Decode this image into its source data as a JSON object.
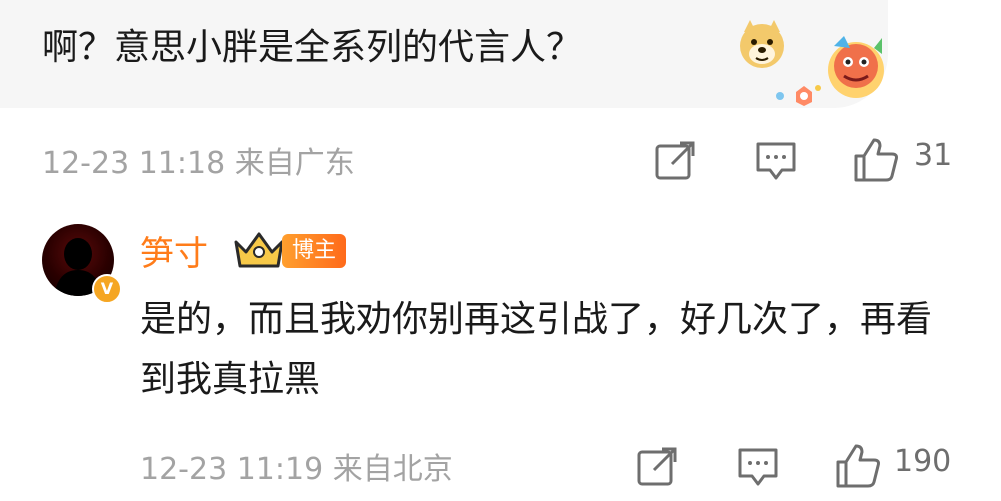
{
  "top_comment": {
    "text": "啊？意思小胖是全系列的代言人？",
    "emoji_name": "doge-emoji",
    "decoration": "lion-dance-badge",
    "date_time": "12-23 11:18",
    "location": "来自广东",
    "like_count": "31"
  },
  "reply": {
    "username": "笋寸",
    "crown_badge": "crown-icon",
    "role_tag": "博主",
    "text": "是的，而且我劝你别再这引战了，好几次了，再看到我真拉黑",
    "date_time": "12-23 11:19",
    "location": "来自北京",
    "like_count": "190"
  },
  "colors": {
    "username": "#ff7c1a",
    "meta_gray": "#a3a3a3",
    "icon_gray": "#6e6e6e",
    "bubble_bg": "#f6f6f6",
    "tag_gradient_start": "#ff9f2e",
    "tag_gradient_end": "#ff6a1a"
  }
}
